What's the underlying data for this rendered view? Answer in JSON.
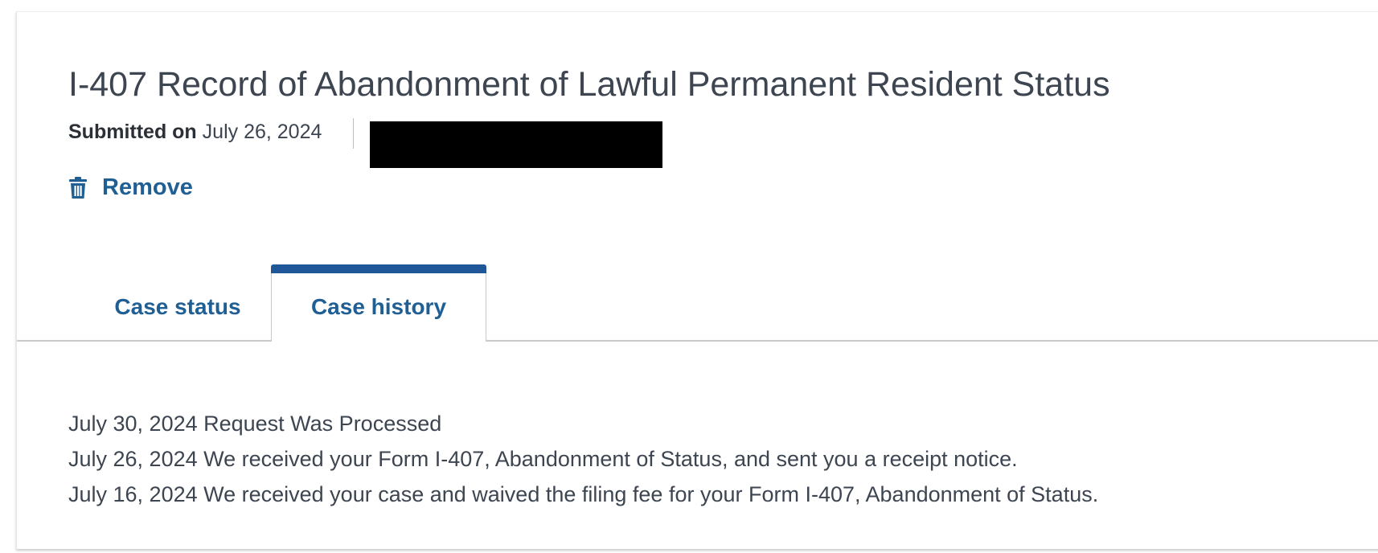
{
  "case": {
    "title": "I-407 Record of Abandonment of Lawful Permanent Resident Status",
    "submitted_label": "Submitted on",
    "submitted_date": "July 26, 2024",
    "remove_label": "Remove"
  },
  "tabs": [
    {
      "label": "Case status",
      "active": false
    },
    {
      "label": "Case history",
      "active": true
    }
  ],
  "history": [
    {
      "text": "July 30, 2024 Request Was Processed"
    },
    {
      "text": "July 26, 2024 We received your Form I-407, Abandonment of Status, and sent you a receipt notice."
    },
    {
      "text": "July 16, 2024 We received your case and waived the filing fee for your Form I-407, Abandonment of Status."
    }
  ],
  "icons": {
    "remove": "trash-icon"
  },
  "colors": {
    "accent": "#1f5f94",
    "active_tab_bar": "#1f5799",
    "text": "#3d4551"
  }
}
